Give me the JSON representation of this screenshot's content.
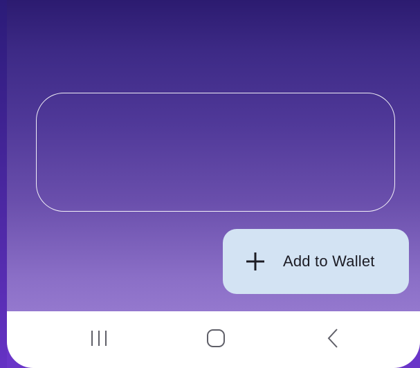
{
  "wallet_card": {},
  "add_button": {
    "label": "Add to Wallet",
    "icon": "plus-icon",
    "background": "#d3e3f3"
  },
  "navigation_bar": {
    "buttons": [
      {
        "icon": "recents-icon"
      },
      {
        "icon": "home-icon"
      },
      {
        "icon": "back-icon"
      }
    ]
  },
  "colors": {
    "gradient_top": "#2c1b70",
    "gradient_bottom": "#a589db",
    "nav_background": "#ffffff",
    "nav_icon": "#5f5f68"
  }
}
